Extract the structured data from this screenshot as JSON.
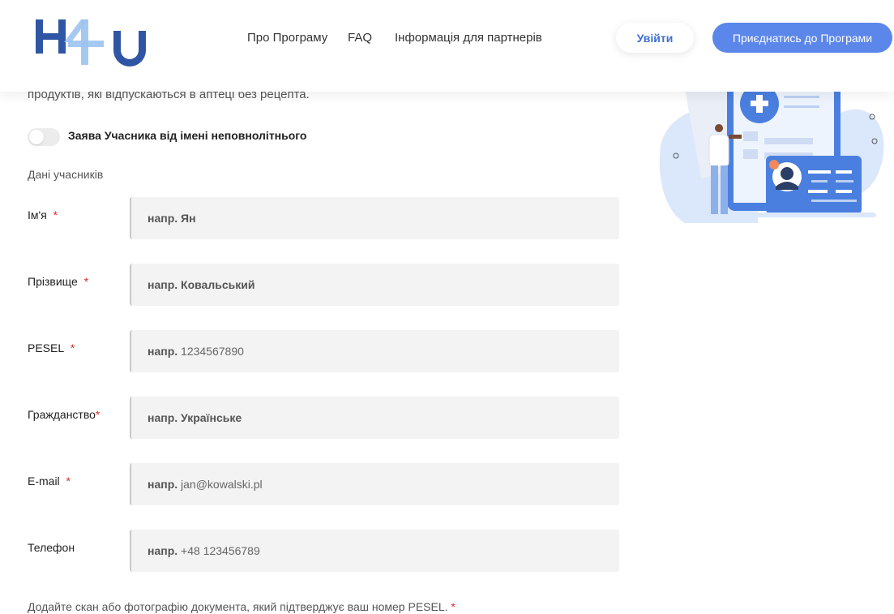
{
  "header": {
    "nav": [
      "Про Програму",
      "FAQ",
      "Інформація для партнерів"
    ],
    "login_label": "Увійти",
    "join_label": "Приєднатись до Програми"
  },
  "colors": {
    "accent": "#5b86ea",
    "logo_dark": "#2f56a4",
    "logo_light": "#9cc3f0",
    "required": "#e02a2a"
  },
  "form": {
    "intro_tail": "продуктів, які відпускаються в аптеці без рецепта.",
    "minor_toggle_label": "Заява Учасника від імені неповнолітнього",
    "minor_toggle_on": false,
    "section_title": "Дані учасників",
    "required_mark": "*",
    "fields": [
      {
        "label": "Ім'я",
        "required": true,
        "placeholder_prefix": "напр.",
        "placeholder_value": "Ян",
        "value_bold": true
      },
      {
        "label": "Прізвище",
        "required": true,
        "placeholder_prefix": "напр.",
        "placeholder_value": "Ковальський",
        "value_bold": true
      },
      {
        "label": "PESEL",
        "required": true,
        "placeholder_prefix": "напр.",
        "placeholder_value": "1234567890",
        "value_bold": false
      },
      {
        "label": "Гражданство",
        "required": true,
        "placeholder_prefix": "напр.",
        "placeholder_value": "Українське",
        "value_bold": true
      },
      {
        "label": "E-mail",
        "required": true,
        "placeholder_prefix": "напр.",
        "placeholder_value": "jan@kowalski.pl",
        "value_bold": false
      },
      {
        "label": "Телефон",
        "required": false,
        "placeholder_prefix": "напр.",
        "placeholder_value": "+48 123456789",
        "value_bold": false
      }
    ],
    "document_note": "Додайте скан або фотографію документа, який підтверджує ваш номер PESEL."
  },
  "logo": {
    "left": "H",
    "digit": "4",
    "right": "U"
  }
}
